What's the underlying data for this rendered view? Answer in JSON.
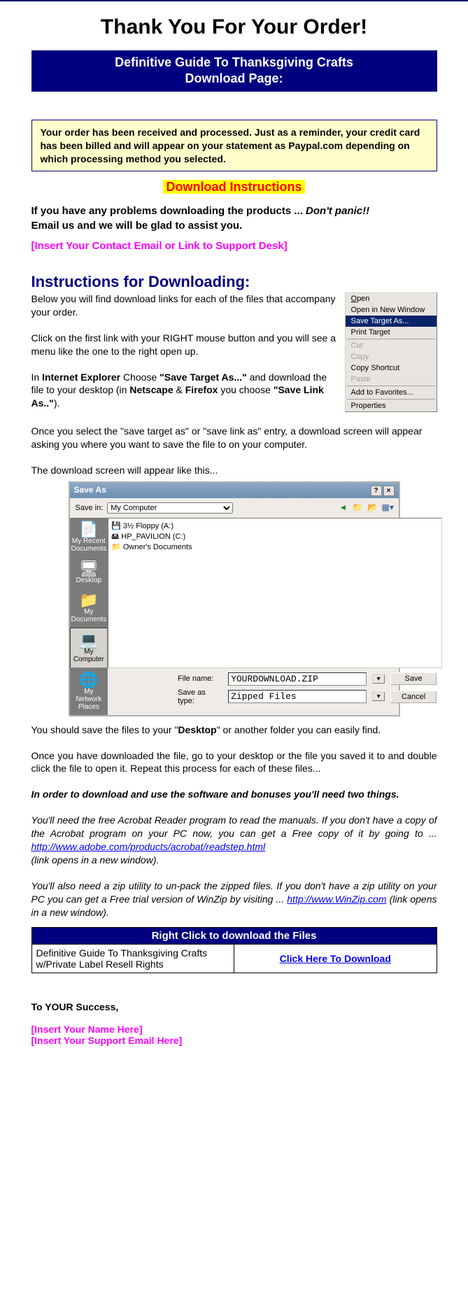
{
  "main_title": "Thank You For Your Order!",
  "banner_line1": "Definitive Guide To Thanksgiving Crafts",
  "banner_line2": "Download Page:",
  "yellow_box": "Your order has been received and processed. Just as a reminder, your credit card has been billed and will appear on your statement as Paypal.com depending on which processing method you selected.",
  "dl_label": "Download Instructions",
  "problems_line1a": "If you have any problems downloading the products ... ",
  "problems_line1b": "Don't panic!!",
  "problems_line2": "Email us and we will be glad to assist you.",
  "contact_placeholder": "[Insert Your Contact Email or Link to Support Desk]",
  "instr_header": "Instructions for Downloading:",
  "context_menu": {
    "open": "Open",
    "open_new": "Open in New Window",
    "save_target": "Save Target As...",
    "print_target": "Print Target",
    "cut": "Cut",
    "copy": "Copy",
    "copy_shortcut": "Copy Shortcut",
    "paste": "Paste",
    "add_fav": "Add to Favorites...",
    "properties": "Properties"
  },
  "para1": "Below you will find download links for each of the files that accompany your order.",
  "para2": "Click on the first link with your RIGHT mouse button and you will see a menu like the one to the right open up.",
  "para3_a": "In ",
  "para3_b": "Internet Explorer",
  "para3_c": " Choose ",
  "para3_d": "\"Save Target As...\"",
  "para3_e": " and download the file to your desktop (in ",
  "para3_f": "Netscape",
  "para3_g": " & ",
  "para3_h": "Firefox",
  "para3_i": " you choose ",
  "para3_j": "\"Save Link As..\"",
  "para3_k": ").",
  "para4": "Once you select the \"save target as\" or \"save link as\" entry, a download screen will appear asking you where you want to save the file to on your computer.",
  "para5": "The download screen will appear like this...",
  "save_dialog": {
    "title": "Save As",
    "save_in_label": "Save in:",
    "save_in_value": "My Computer",
    "places": [
      "My Recent Documents",
      "Desktop",
      "My Documents",
      "My Computer",
      "My Network Places"
    ],
    "listing": [
      "3½ Floppy (A:)",
      "HP_PAVILION (C:)",
      "Owner's Documents"
    ],
    "file_name_label": "File name:",
    "file_name_value": "YOURDOWNLOAD.ZIP",
    "save_type_label": "Save as type:",
    "save_type_value": "Zipped Files",
    "save_btn": "Save",
    "cancel_btn": "Cancel"
  },
  "para6_a": "You should save the files to your \"",
  "para6_b": "Desktop",
  "para6_c": "\" or another folder you can easily find.",
  "para7": "Once you have downloaded the file, go to your desktop or the file you saved it to and double click the file to open it.  Repeat this process for each of these files...",
  "para8": "In order to download and use the software and bonuses you'll need two things.",
  "para9_a": "You'll need the free Acrobat Reader program to read the manuals. If you don't have a copy of the Acrobat program on your PC now, you can get a Free copy of it by going to ... ",
  "para9_link": "http://www.adobe.com/products/acrobat/readstep.html",
  "para9_b": "(link opens in a new window).",
  "para10_a": "You'll also need a zip utility to un-pack the zipped files. If you don't have a zip utility on your PC you can get a Free trial version of WinZip by visiting ... ",
  "para10_link": "http://www.WinZip.com",
  "para10_b": "  (link opens in a new window).",
  "table": {
    "header": "Right Click to download the Files",
    "product": "Definitive Guide To Thanksgiving Crafts w/Private Label Resell Rights",
    "link": "Click Here To Download"
  },
  "signoff": {
    "success": "To YOUR Success,",
    "name": "[Insert Your Name Here]",
    "email": "[Insert Your Support Email Here]"
  }
}
